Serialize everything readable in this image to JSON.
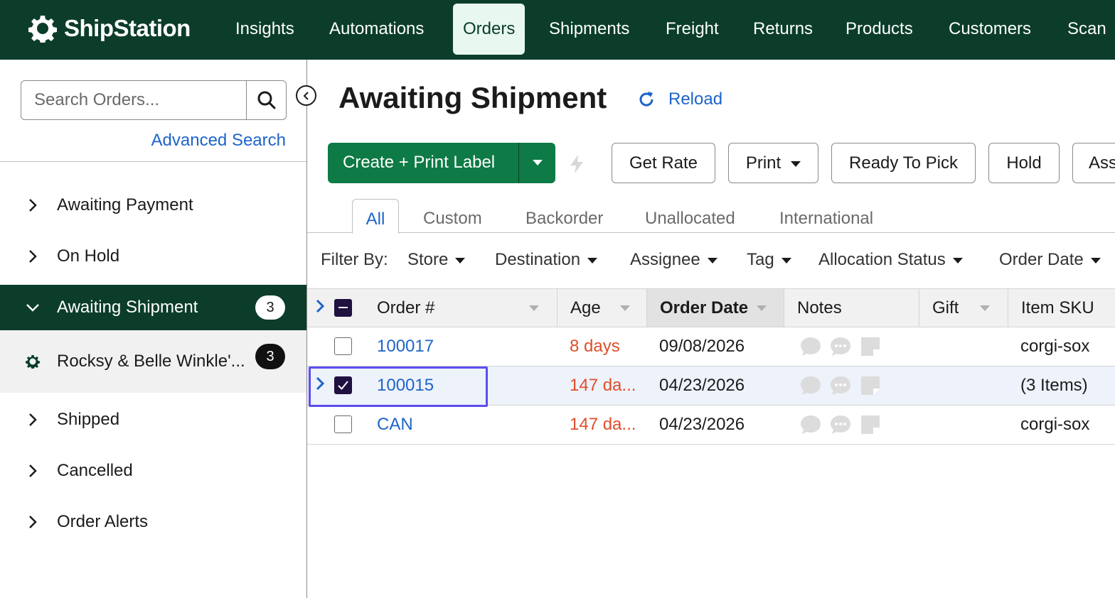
{
  "app": {
    "logo_text": "ShipStation"
  },
  "nav": {
    "items": [
      "Insights",
      "Automations",
      "Orders",
      "Shipments",
      "Freight",
      "Returns",
      "Products",
      "Customers",
      "Scan"
    ]
  },
  "sidebar": {
    "search_placeholder": "Search Orders...",
    "advanced_search": "Advanced Search",
    "items": [
      {
        "label": "Awaiting Payment"
      },
      {
        "label": "On Hold"
      },
      {
        "label": "Awaiting Shipment",
        "badge": "3"
      },
      {
        "label": "Rocksy & Belle Winkle'...",
        "badge": "3"
      },
      {
        "label": "Shipped"
      },
      {
        "label": "Cancelled"
      },
      {
        "label": "Order Alerts"
      }
    ]
  },
  "main": {
    "title": "Awaiting Shipment",
    "reload": "Reload",
    "toolbar": {
      "primary": "Create + Print Label",
      "get_rate": "Get Rate",
      "print": "Print",
      "ready_to_pick": "Ready To Pick",
      "hold": "Hold",
      "assign": "Ass"
    },
    "tabs": [
      "All",
      "Custom",
      "Backorder",
      "Unallocated",
      "International"
    ],
    "filter_label": "Filter By:",
    "filters": [
      "Store",
      "Destination",
      "Assignee",
      "Tag",
      "Allocation Status",
      "Order Date"
    ]
  },
  "table": {
    "columns": [
      "Order #",
      "Age",
      "Order Date",
      "Notes",
      "Gift",
      "Item SKU"
    ],
    "rows": [
      {
        "order": "100017",
        "age": "8 days",
        "date": "09/08/2026",
        "sku": "corgi-sox",
        "checked": false
      },
      {
        "order": "100015",
        "age": "147 da...",
        "date": "04/23/2026",
        "sku": "(3 Items)",
        "checked": true
      },
      {
        "order": "CAN",
        "age": "147 da...",
        "date": "04/23/2026",
        "sku": "corgi-sox",
        "checked": false
      }
    ]
  },
  "colors": {
    "nav_bg": "#0b3d2a",
    "primary_green": "#0e7a45",
    "link_blue": "#1e64c8",
    "age_red": "#e04e2b",
    "highlight": "#5b4ef0"
  }
}
